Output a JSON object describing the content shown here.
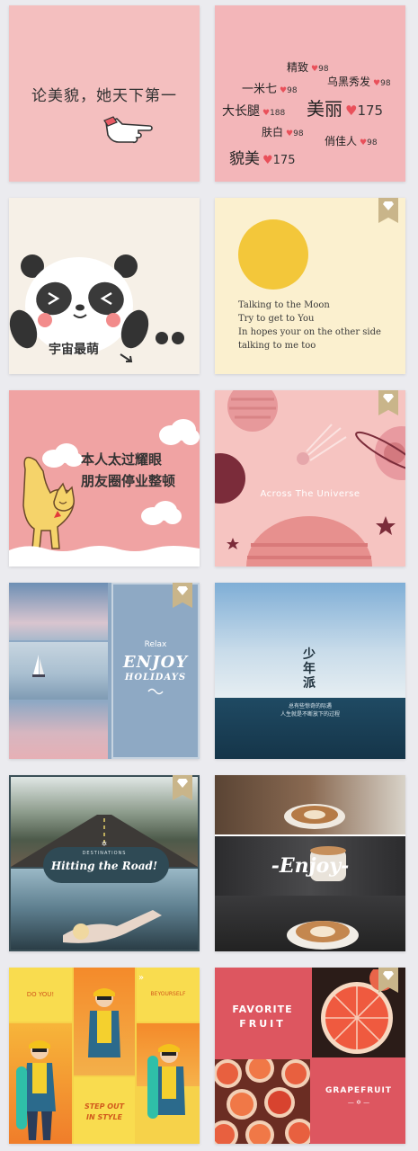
{
  "card1": {
    "title": "论美貌，她天下第一"
  },
  "card2": {
    "words": [
      {
        "text": "精致",
        "count": "98"
      },
      {
        "text": "一米七",
        "count": "98"
      },
      {
        "text": "乌黑秀发",
        "count": "98"
      },
      {
        "text": "大长腿",
        "count": "188"
      },
      {
        "text": "美丽",
        "count": "175"
      },
      {
        "text": "肤白",
        "count": "98"
      },
      {
        "text": "俏佳人",
        "count": "98"
      },
      {
        "text": "貌美",
        "count": "175"
      }
    ]
  },
  "card3": {
    "caption": "宇宙最萌"
  },
  "card4": {
    "lines": [
      "Talking to the Moon",
      "Try to get to You",
      "In hopes your on the other side",
      "talking to me too"
    ]
  },
  "card5": {
    "line1": "本人太过耀眼",
    "line2": "朋友圈停业整顿"
  },
  "card6": {
    "caption": "Across The Universe"
  },
  "card7": {
    "relax": "Relax",
    "enjoy": "ENJOY",
    "holidays": "HOLIDAYS"
  },
  "card8": {
    "title": "少年派",
    "sub1": "总有些惊奇的际遇",
    "sub2": "人生就是不断放下的过程"
  },
  "card9": {
    "kicker": "DESTINATIONS",
    "title": "Hitting the Road!"
  },
  "card10": {
    "word": "-Enjoy-"
  },
  "card11": {
    "left": "DO YOU!",
    "right": "BEYOURSELF",
    "cta1": "STEP OUT",
    "cta2": "IN STYLE"
  },
  "card12": {
    "fav1": "FAVORITE",
    "fav2": "FRUIT",
    "name": "GRAPEFRUIT"
  },
  "colors": {
    "pink": "#f4bfbf",
    "heart": "#e9505a",
    "gold-badge": "#c9b58a",
    "fruit-red": "#dd5660"
  }
}
